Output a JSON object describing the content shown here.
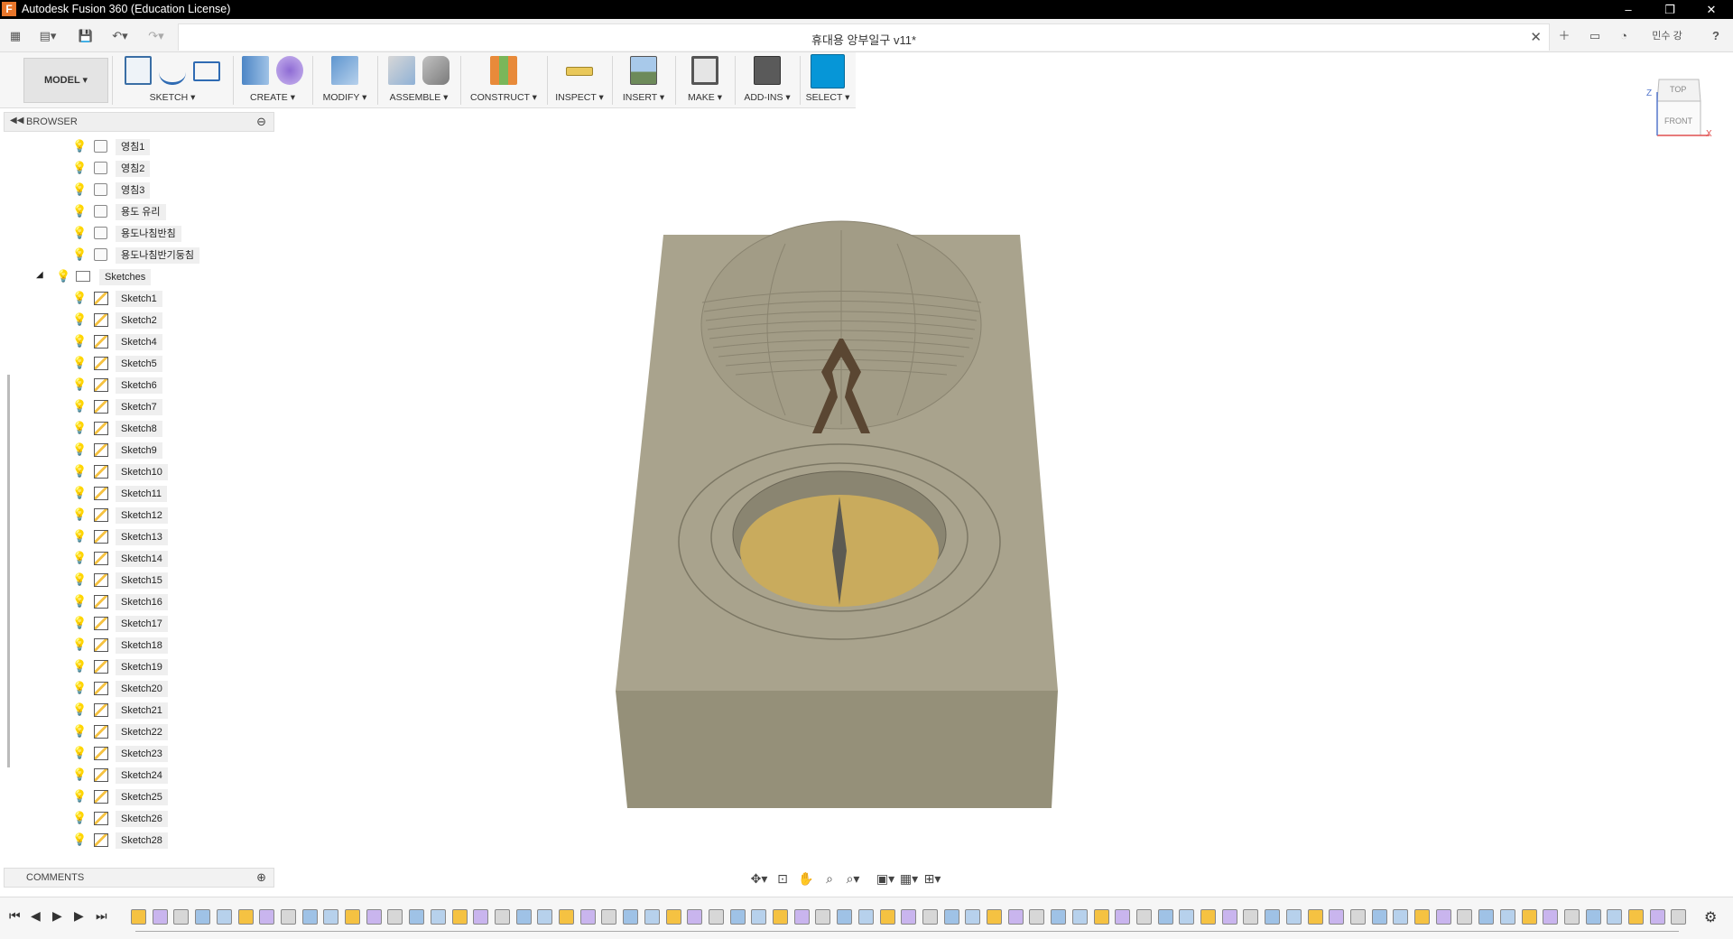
{
  "app": {
    "title": "Autodesk Fusion 360 (Education License)",
    "logo": "F"
  },
  "window_controls": {
    "minimize": "–",
    "restore": "❐",
    "close": "✕"
  },
  "appbar": {
    "user": "민수 강",
    "help": "?"
  },
  "doc_tab": {
    "title": "휴대용 앙부일구 v11*",
    "close": "✕"
  },
  "workspace": {
    "label": "MODEL ▾"
  },
  "toolbar": {
    "groups": [
      {
        "label": "SKETCH ▾"
      },
      {
        "label": "CREATE ▾"
      },
      {
        "label": "MODIFY ▾"
      },
      {
        "label": "ASSEMBLE ▾"
      },
      {
        "label": "CONSTRUCT ▾"
      },
      {
        "label": "INSPECT ▾"
      },
      {
        "label": "INSERT ▾"
      },
      {
        "label": "MAKE ▾"
      },
      {
        "label": "ADD-INS ▾"
      },
      {
        "label": "SELECT ▾"
      }
    ]
  },
  "browser": {
    "title": "BROWSER",
    "bodies": [
      "영침1",
      "영침2",
      "영침3",
      "용도 유리",
      "용도나침반침",
      "용도나침반기둥침"
    ],
    "sketches_folder": "Sketches",
    "sketches": [
      "Sketch1",
      "Sketch2",
      "Sketch4",
      "Sketch5",
      "Sketch6",
      "Sketch7",
      "Sketch8",
      "Sketch9",
      "Sketch10",
      "Sketch11",
      "Sketch12",
      "Sketch13",
      "Sketch14",
      "Sketch15",
      "Sketch16",
      "Sketch17",
      "Sketch18",
      "Sketch19",
      "Sketch20",
      "Sketch21",
      "Sketch22",
      "Sketch23",
      "Sketch24",
      "Sketch25",
      "Sketch26",
      "Sketch28"
    ]
  },
  "comments": {
    "title": "COMMENTS"
  },
  "viewcube": {
    "top": "TOP",
    "front": "FRONT",
    "axis_z": "Z",
    "axis_x": "X"
  },
  "colors": {
    "accent": "#0696d7",
    "model_top": "#a9a38d",
    "model_front": "#959079",
    "compass_face": "#c9ab5d",
    "gnomon": "#5a4632"
  }
}
